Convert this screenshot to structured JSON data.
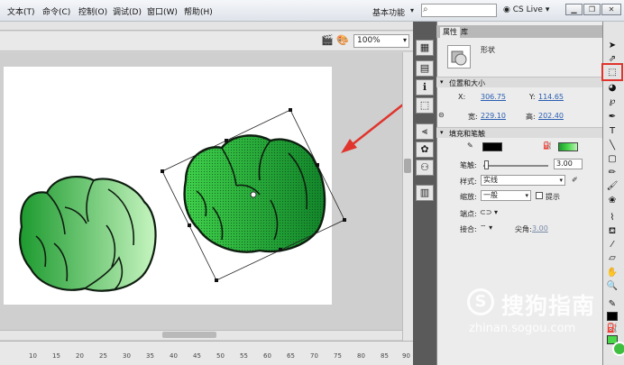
{
  "menu": {
    "items": [
      "文本(T)",
      "命令(C)",
      "控制(O)",
      "调试(D)",
      "窗口(W)",
      "帮助(H)"
    ],
    "workspace": "基本功能",
    "search_placeholder": "",
    "cslive": "CS Live"
  },
  "window_buttons": [
    "minimize-icon",
    "restore-icon",
    "close-icon"
  ],
  "document": {
    "zoom": "100%"
  },
  "ruler": {
    "ticks": [
      "10",
      "15",
      "20",
      "25",
      "30",
      "35",
      "40",
      "45",
      "50",
      "55",
      "60",
      "65",
      "70",
      "75",
      "80",
      "85",
      "90"
    ]
  },
  "panel": {
    "tabs": [
      "属性",
      "库"
    ],
    "object_type": "形状",
    "position_section": "位置和大小",
    "x_label": "X:",
    "x_value": "306.75",
    "y_label": "Y:",
    "y_value": "114.65",
    "w_label": "宽:",
    "w_value": "229.10",
    "h_label": "高:",
    "h_value": "202.40",
    "fill_section": "填充和笔触",
    "stroke_color": "#000000",
    "fill_color": "#4ad84a",
    "stroke_label": "笔触:",
    "stroke_value": "3.00",
    "style_label": "样式:",
    "style_value": "实线",
    "scale_label": "缩放:",
    "scale_value": "一般",
    "hint_label": "提示",
    "cap_label": "端点:",
    "join_label": "接合:",
    "miter_label": "尖角:",
    "miter_value": "3.00"
  },
  "watermark": {
    "logo": "S",
    "text": "搜狗指南",
    "url": "zhinan.sogou.com"
  },
  "colors": {
    "highlight": "#e0342c",
    "cabbage_dark": "#1c9a2e",
    "cabbage_light": "#bff2b9"
  }
}
